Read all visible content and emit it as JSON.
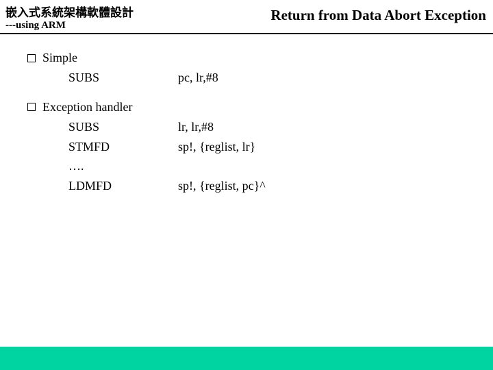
{
  "header": {
    "course_title": "嵌入式系統架構軟體設計",
    "course_sub": "---using ARM",
    "slide_title": "Return from Data Abort Exception"
  },
  "sections": [
    {
      "heading": "Simple",
      "lines": [
        {
          "mnemonic": "SUBS",
          "operands": "pc, lr,#8"
        }
      ]
    },
    {
      "heading": "Exception handler",
      "lines": [
        {
          "mnemonic": "SUBS",
          "operands": "lr, lr,#8"
        },
        {
          "mnemonic": "STMFD",
          "operands": "sp!, {reglist, lr}"
        },
        {
          "mnemonic": "….",
          "operands": ""
        },
        {
          "mnemonic": "LDMFD",
          "operands": "sp!, {reglist, pc}^"
        }
      ]
    }
  ]
}
